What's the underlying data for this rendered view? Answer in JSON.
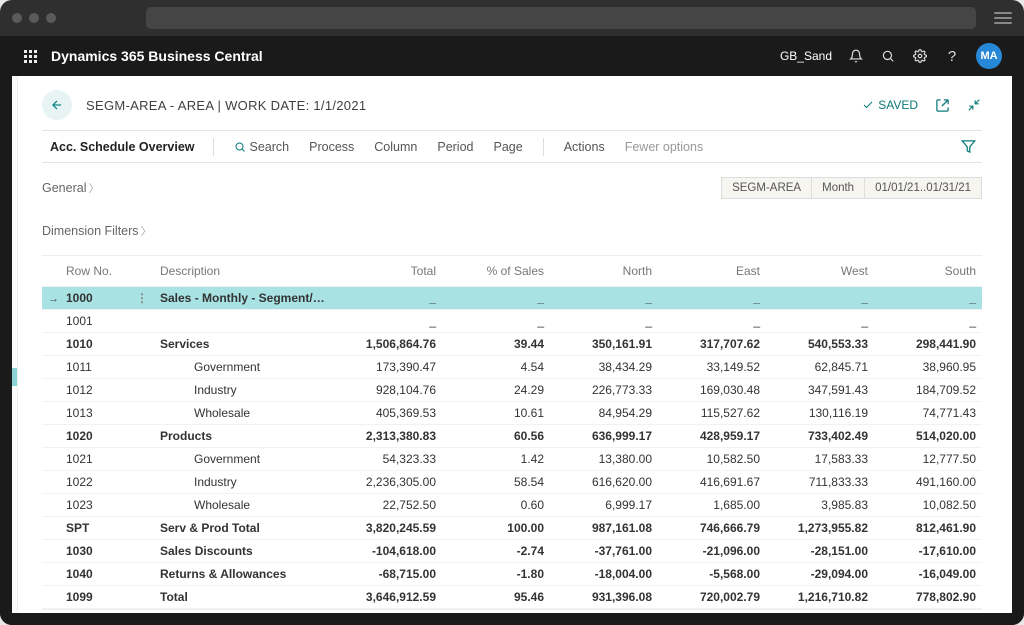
{
  "topbar": {
    "product": "Dynamics 365 Business Central",
    "environment": "GB_Sand",
    "avatar_initials": "MA"
  },
  "header": {
    "title": "SEGM-AREA - AREA | WORK DATE: 1/1/2021",
    "saved_label": "SAVED"
  },
  "commandbar": {
    "tab_label": "Acc. Schedule Overview",
    "search_label": "Search",
    "items": [
      "Process",
      "Column",
      "Period",
      "Page"
    ],
    "actions_label": "Actions",
    "fewer_label": "Fewer options"
  },
  "general": {
    "label": "General",
    "pills": [
      "SEGM-AREA",
      "Month",
      "01/01/21..01/31/21"
    ]
  },
  "dimension_filters_label": "Dimension Filters",
  "grid": {
    "columns": [
      "Row No.",
      "Description",
      "Total",
      "% of Sales",
      "North",
      "East",
      "West",
      "South"
    ],
    "rows": [
      {
        "rowno": "1000",
        "desc": "Sales - Monthly - Segment/Area",
        "indent": 0,
        "bold": true,
        "selected": true,
        "values": [
          "_",
          "_",
          "_",
          "_",
          "_",
          "_"
        ]
      },
      {
        "rowno": "1001",
        "desc": "",
        "indent": 0,
        "bold": false,
        "values": [
          "_",
          "_",
          "_",
          "_",
          "_",
          "_"
        ]
      },
      {
        "rowno": "1010",
        "desc": "Services",
        "indent": 0,
        "bold": true,
        "values": [
          "1,506,864.76",
          "39.44",
          "350,161.91",
          "317,707.62",
          "540,553.33",
          "298,441.90"
        ]
      },
      {
        "rowno": "1011",
        "desc": "Government",
        "indent": 2,
        "bold": false,
        "values": [
          "173,390.47",
          "4.54",
          "38,434.29",
          "33,149.52",
          "62,845.71",
          "38,960.95"
        ]
      },
      {
        "rowno": "1012",
        "desc": "Industry",
        "indent": 2,
        "bold": false,
        "values": [
          "928,104.76",
          "24.29",
          "226,773.33",
          "169,030.48",
          "347,591.43",
          "184,709.52"
        ]
      },
      {
        "rowno": "1013",
        "desc": "Wholesale",
        "indent": 2,
        "bold": false,
        "values": [
          "405,369.53",
          "10.61",
          "84,954.29",
          "115,527.62",
          "130,116.19",
          "74,771.43"
        ]
      },
      {
        "rowno": "1020",
        "desc": "Products",
        "indent": 0,
        "bold": true,
        "values": [
          "2,313,380.83",
          "60.56",
          "636,999.17",
          "428,959.17",
          "733,402.49",
          "514,020.00"
        ]
      },
      {
        "rowno": "1021",
        "desc": "Government",
        "indent": 2,
        "bold": false,
        "values": [
          "54,323.33",
          "1.42",
          "13,380.00",
          "10,582.50",
          "17,583.33",
          "12,777.50"
        ]
      },
      {
        "rowno": "1022",
        "desc": "Industry",
        "indent": 2,
        "bold": false,
        "values": [
          "2,236,305.00",
          "58.54",
          "616,620.00",
          "416,691.67",
          "711,833.33",
          "491,160.00"
        ]
      },
      {
        "rowno": "1023",
        "desc": "Wholesale",
        "indent": 2,
        "bold": false,
        "values": [
          "22,752.50",
          "0.60",
          "6,999.17",
          "1,685.00",
          "3,985.83",
          "10,082.50"
        ]
      },
      {
        "rowno": "SPT",
        "desc": "Serv & Prod Total",
        "indent": 0,
        "bold": true,
        "values": [
          "3,820,245.59",
          "100.00",
          "987,161.08",
          "746,666.79",
          "1,273,955.82",
          "812,461.90"
        ]
      },
      {
        "rowno": "1030",
        "desc": "Sales Discounts",
        "indent": 0,
        "bold": true,
        "values": [
          "-104,618.00",
          "-2.74",
          "-37,761.00",
          "-21,096.00",
          "-28,151.00",
          "-17,610.00"
        ]
      },
      {
        "rowno": "1040",
        "desc": "Returns & Allowances",
        "indent": 0,
        "bold": true,
        "values": [
          "-68,715.00",
          "-1.80",
          "-18,004.00",
          "-5,568.00",
          "-29,094.00",
          "-16,049.00"
        ]
      },
      {
        "rowno": "1099",
        "desc": "Total",
        "indent": 0,
        "bold": true,
        "values": [
          "3,646,912.59",
          "95.46",
          "931,396.08",
          "720,002.79",
          "1,216,710.82",
          "778,802.90"
        ]
      }
    ]
  }
}
